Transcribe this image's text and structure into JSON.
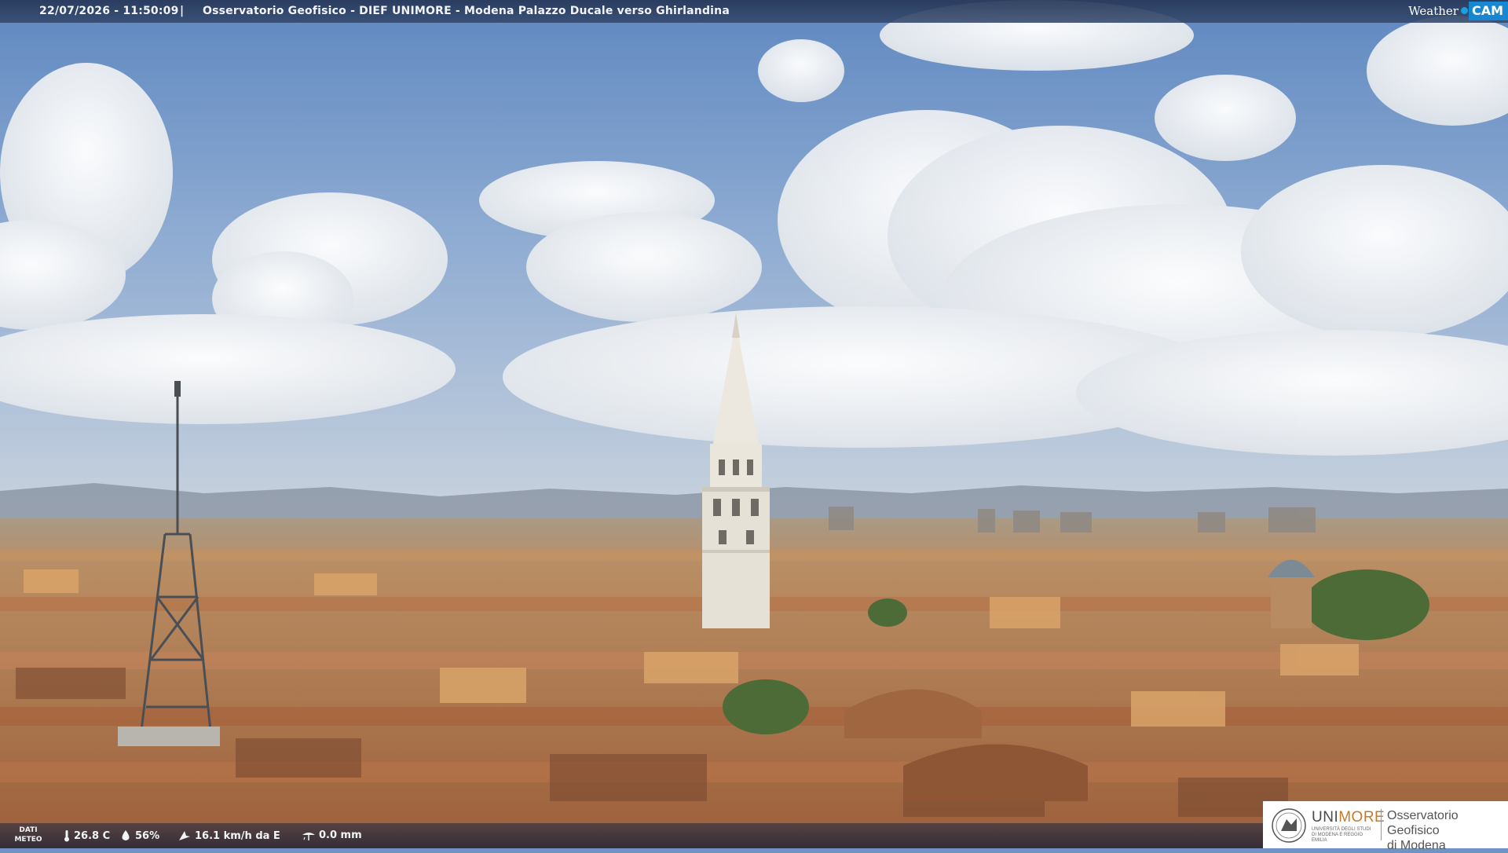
{
  "overlay": {
    "timestamp": "22/07/2026 - 11:50:09",
    "separator": "|",
    "camera_title": "Osservatorio Geofisico - DIEF UNIMORE - Modena Palazzo Ducale verso Ghirlandina",
    "brand_left": "Weather",
    "brand_right": "CAM"
  },
  "meteo": {
    "label_line1": "DATI",
    "label_line2": "METEO",
    "temperature": "26.8 C",
    "humidity": "56%",
    "wind": "16.1 km/h da E",
    "rain": "0.0 mm"
  },
  "logo": {
    "uni_part1": "UNI",
    "uni_part2": "MORE",
    "uni_sub": "UNIVERSITÀ DEGLI STUDI DI MODENA E REGGIO EMILIA",
    "observatory_line1": "Osservatorio Geofisico",
    "observatory_line2": "di Modena"
  },
  "colors": {
    "sky": "#6f93c4",
    "roofs": "#b87a4e",
    "tower_stone": "#e8e3d8",
    "overlay_bar": "#26375a",
    "brand_blue": "#1787d2",
    "unimore_accent": "#c87a2a"
  }
}
